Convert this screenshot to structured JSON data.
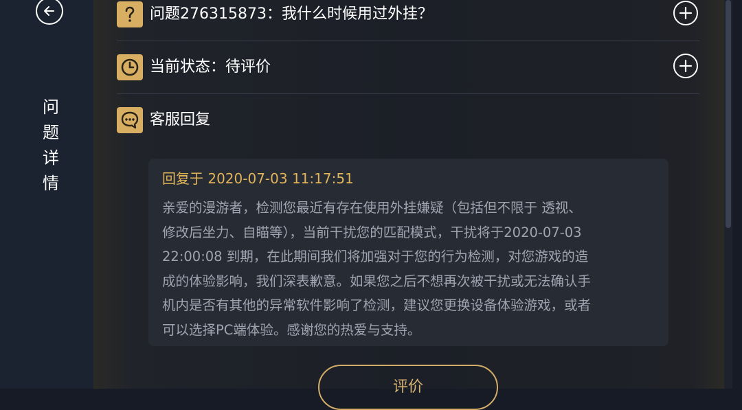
{
  "colors": {
    "accent_gold": "#d7ae62",
    "reply_time": "#e2b45a",
    "body_text": "#9fa5b0"
  },
  "sidebar": {
    "back_icon": "arrow-left-icon",
    "title_chars": [
      "问",
      "题",
      "详",
      "情"
    ]
  },
  "rows": {
    "question": {
      "icon": "question-mark-icon",
      "label": "问题276315873：我什么时候用过外挂？",
      "action_icon": "plus-circle-icon"
    },
    "status": {
      "icon": "clock-icon",
      "label": "当前状态：待评价",
      "action_icon": "plus-circle-icon"
    },
    "reply": {
      "icon": "chat-bubble-icon",
      "label": "客服回复"
    }
  },
  "reply": {
    "time": "回复于 2020-07-03 11:17:51",
    "lines": [
      "亲爱的漫游者，检测您最近有存在使用外挂嫌疑（包括但不限于 透视、",
      "修改后坐力、自瞄等），当前干扰您的匹配模式，干扰将于2020-07-03",
      "22:00:08 到期，在此期间我们将加强对于您的行为检测，对您游戏的造",
      "成的体验影响，我们深表歉意。如果您之后不想再次被干扰或无法确认手",
      "机内是否有其他的异常软件影响了检测，建议您更换设备体验游戏，或者",
      "可以选择PC端体验。感谢您的热爱与支持。"
    ]
  },
  "rate_button": {
    "label": "评价"
  }
}
